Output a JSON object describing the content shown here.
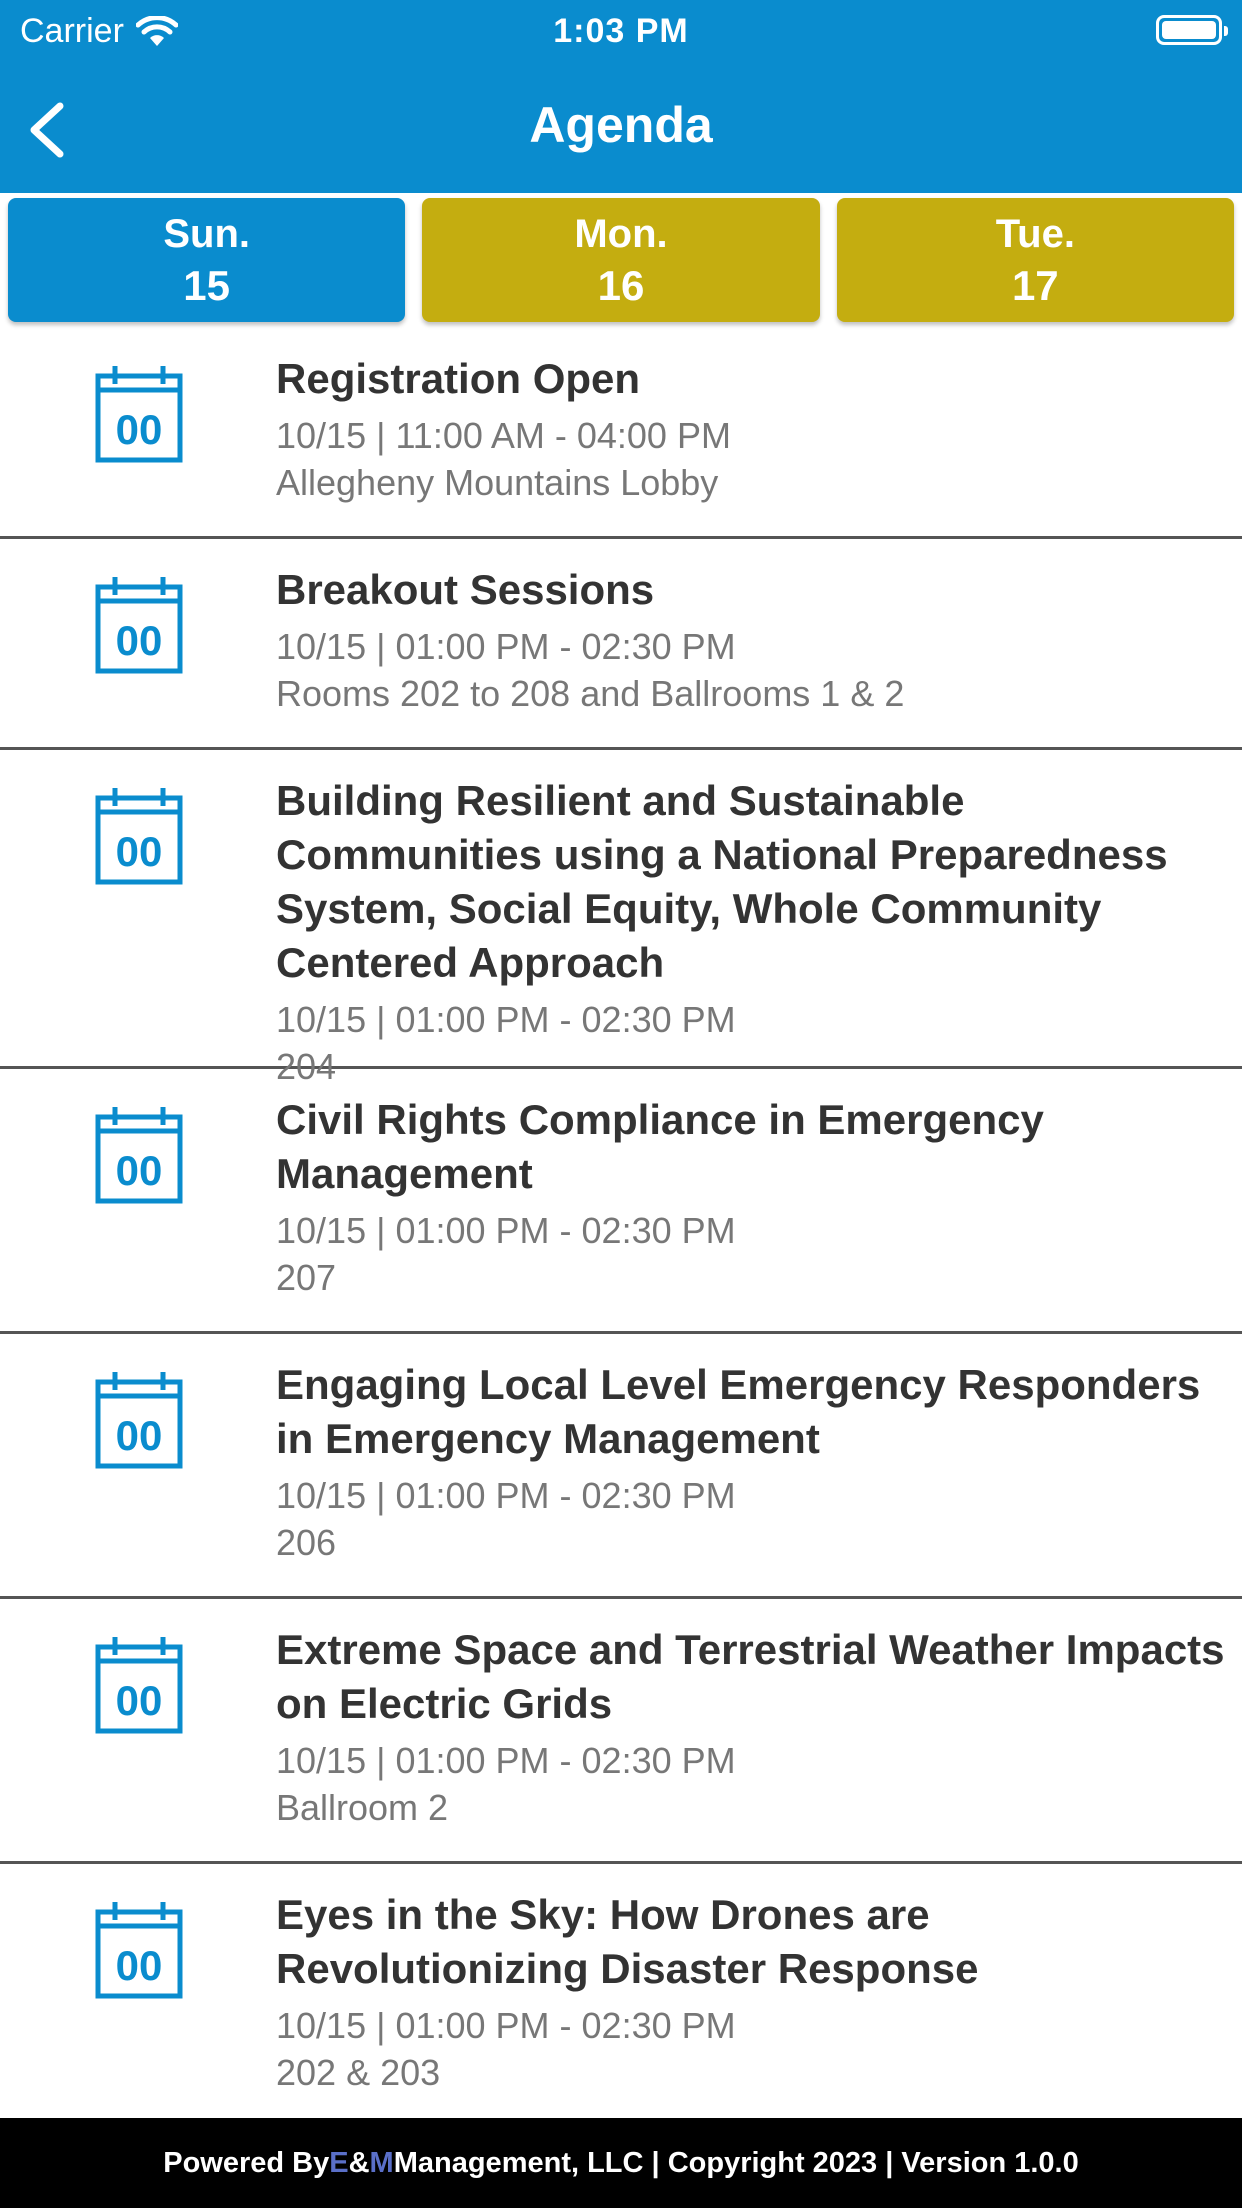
{
  "status": {
    "carrier": "Carrier",
    "time": "1:03 PM"
  },
  "header": {
    "title": "Agenda"
  },
  "colors": {
    "header": "#0a8cce",
    "tab_active": "#0a8cce",
    "tab_inactive": "#c4ad10",
    "icon": "#0a8cce"
  },
  "tabs": [
    {
      "day": "Sun.",
      "num": "15",
      "active": true
    },
    {
      "day": "Mon.",
      "num": "16",
      "active": false
    },
    {
      "day": "Tue.",
      "num": "17",
      "active": false
    }
  ],
  "events": [
    {
      "title": "Registration Open",
      "time": "10/15 | 11:00 AM - 04:00 PM",
      "location": "Allegheny Mountains Lobby",
      "icon": "calendar-icon",
      "icon_text": "00"
    },
    {
      "title": "Breakout Sessions",
      "time": "10/15 | 01:00 PM - 02:30 PM",
      "location": "Rooms 202 to 208 and Ballrooms 1 & 2",
      "icon": "calendar-icon",
      "icon_text": "00"
    },
    {
      "title": "Building Resilient and Sustainable Communities using a National Preparedness System, Social Equity, Whole Community Centered Approach",
      "time": "10/15 | 01:00 PM - 02:30 PM",
      "location": "204",
      "icon": "calendar-icon",
      "icon_text": "00"
    },
    {
      "title": "Civil Rights Compliance in Emergency Management",
      "time": "10/15 | 01:00 PM - 02:30 PM",
      "location": "207",
      "icon": "calendar-icon",
      "icon_text": "00"
    },
    {
      "title": "Engaging Local Level Emergency Responders in Emergency Management",
      "time": "10/15 | 01:00 PM - 02:30 PM",
      "location": "206",
      "icon": "calendar-icon",
      "icon_text": "00"
    },
    {
      "title": "Extreme Space and Terrestrial Weather Impacts on Electric Grids",
      "time": "10/15 | 01:00 PM - 02:30 PM",
      "location": "Ballroom 2",
      "icon": "calendar-icon",
      "icon_text": "00"
    },
    {
      "title": "Eyes in the Sky: How Drones are Revolutionizing Disaster Response",
      "time": "10/15 | 01:00 PM - 02:30 PM",
      "location": "202 & 203",
      "icon": "calendar-icon",
      "icon_text": "00"
    }
  ],
  "footer": {
    "prefix": "Powered By ",
    "e": "E",
    "amp": "&",
    "m": "M",
    "suffix": " Management, LLC | Copyright 2023 | Version 1.0.0"
  }
}
